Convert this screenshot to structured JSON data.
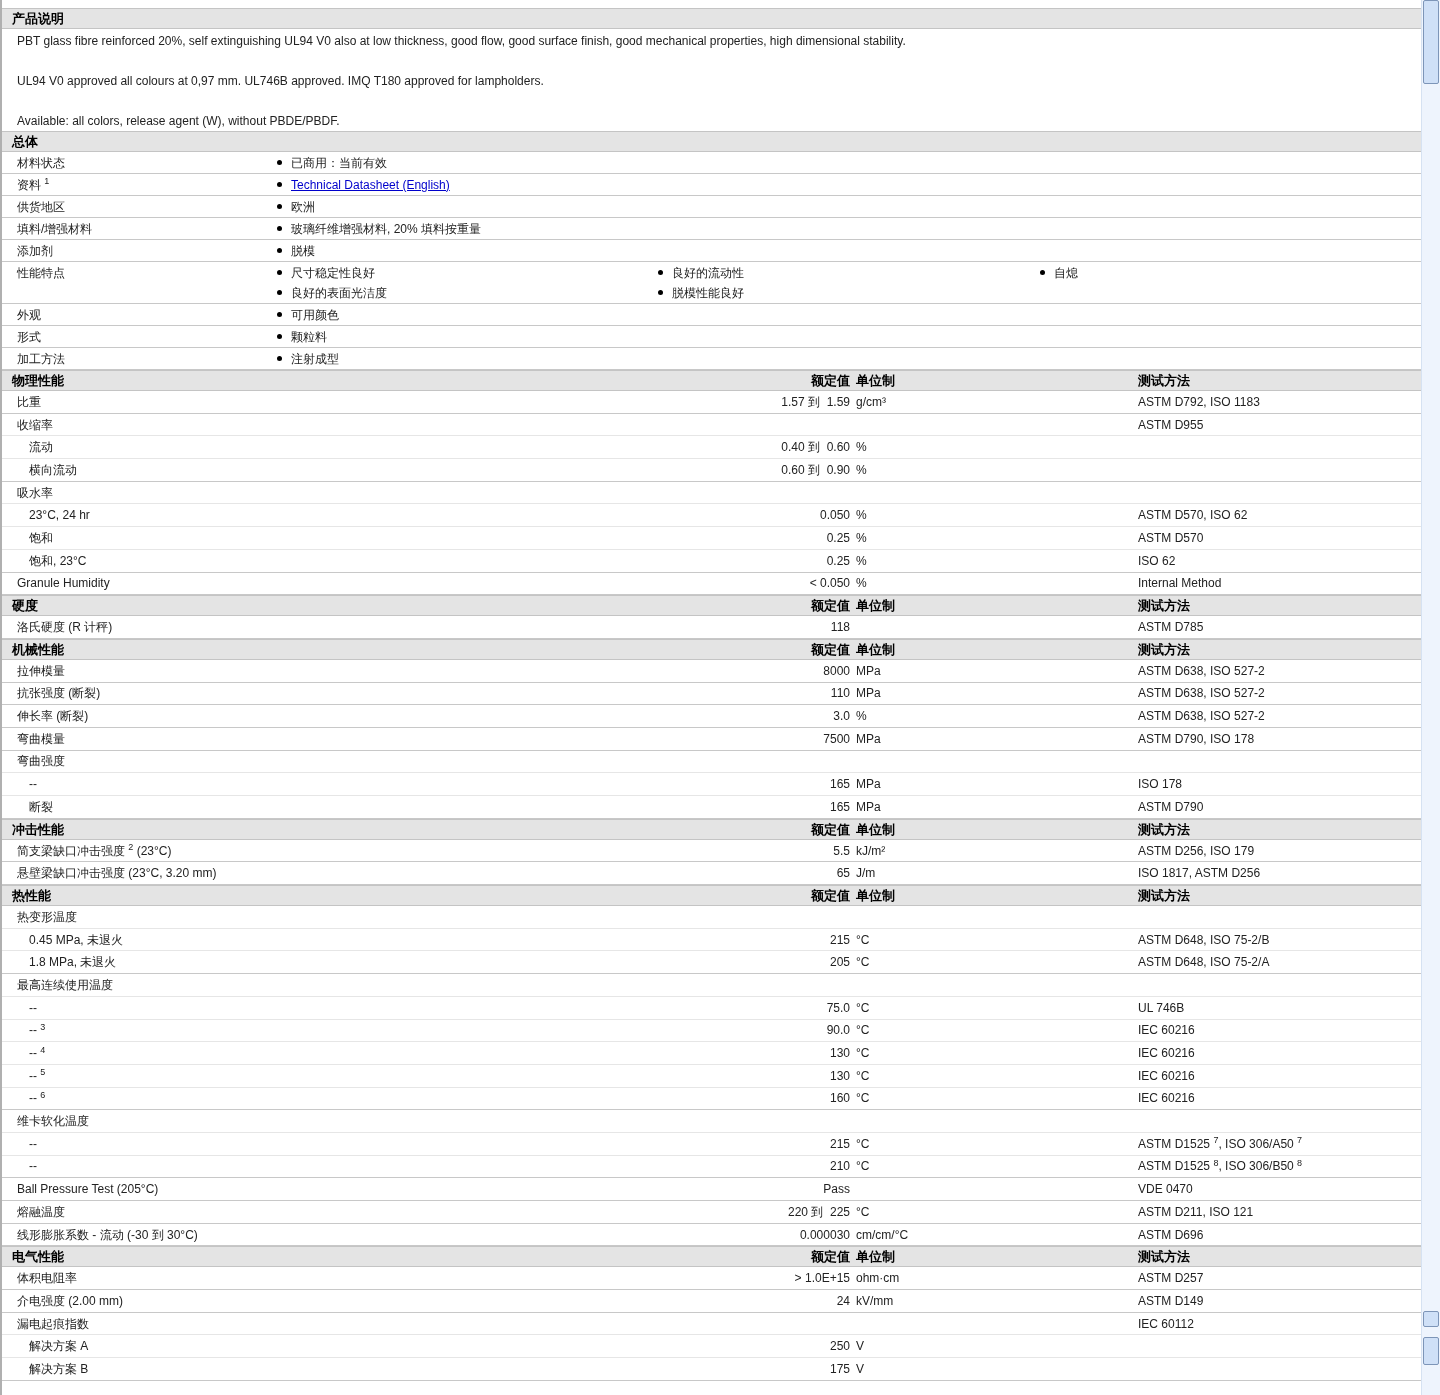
{
  "description": {
    "title": "产品说明",
    "paragraphs": [
      "PBT glass fibre reinforced 20%, self extinguishing UL94 V0 also at low thickness, good flow, good surface finish, good mechanical properties, high dimensional stability.",
      "UL94 V0 approved all colours at 0,97 mm. UL746B approved. IMQ T180 approved for lampholders.",
      "Available: all colors, release agent (W), without PBDE/PBDF."
    ]
  },
  "general": {
    "title": "总体",
    "rows": [
      {
        "label": "材料状态",
        "items": [
          {
            "text": "已商用：当前有效",
            "kind": "text"
          }
        ]
      },
      {
        "label": "资料 $^{1}$",
        "items": [
          {
            "text": "Technical Datasheet (English)",
            "kind": "link"
          }
        ]
      },
      {
        "label": "供货地区",
        "items": [
          {
            "text": "欧洲",
            "kind": "text"
          }
        ]
      },
      {
        "label": "填料/增强材料",
        "items": [
          {
            "text": "玻璃纤维增强材料, 20% 填料按重量",
            "kind": "text"
          }
        ]
      },
      {
        "label": "添加剂",
        "items": [
          {
            "text": "脱模",
            "kind": "text"
          }
        ]
      },
      {
        "label": "性能特点",
        "items": [
          {
            "text": "尺寸稳定性良好",
            "kind": "text"
          },
          {
            "text": "良好的流动性",
            "kind": "text"
          },
          {
            "text": "自熄",
            "kind": "text"
          },
          {
            "text": "良好的表面光洁度",
            "kind": "text"
          },
          {
            "text": "脱模性能良好",
            "kind": "text"
          }
        ]
      },
      {
        "label": "外观",
        "items": [
          {
            "text": "可用颜色",
            "kind": "text"
          }
        ]
      },
      {
        "label": "形式",
        "items": [
          {
            "text": "颗粒料",
            "kind": "text"
          }
        ]
      },
      {
        "label": "加工方法",
        "items": [
          {
            "text": "注射成型",
            "kind": "text"
          }
        ]
      }
    ]
  },
  "sections": [
    {
      "title": "物理性能",
      "value_heading": "额定值",
      "unit_heading": "单位制",
      "method_heading": "测试方法",
      "rows": [
        {
          "label": "比重",
          "value": "1.57 到  1.59",
          "unit": "g/cm³",
          "method": "ASTM D792, ISO 1183"
        },
        {
          "label": "收缩率",
          "method": "ASTM D955",
          "children": [
            {
              "label": "流动",
              "value": "0.40 到  0.60",
              "unit": "%"
            },
            {
              "label": "横向流动",
              "value": "0.60 到  0.90",
              "unit": "%"
            }
          ]
        },
        {
          "label": "吸水率",
          "children": [
            {
              "label": "23°C, 24 hr",
              "value": "0.050",
              "unit": "%",
              "method": "ASTM D570, ISO 62"
            },
            {
              "label": "饱和",
              "value": "0.25",
              "unit": "%",
              "method": "ASTM D570"
            },
            {
              "label": "饱和, 23°C",
              "value": "0.25",
              "unit": "%",
              "method": "ISO 62"
            }
          ]
        },
        {
          "label": "Granule Humidity",
          "value": "< 0.050",
          "unit": "%",
          "method": "Internal Method"
        }
      ]
    },
    {
      "title": "硬度",
      "value_heading": "额定值",
      "unit_heading": "单位制",
      "method_heading": "测试方法",
      "rows": [
        {
          "label": "洛氏硬度 (R 计秤)",
          "value": "118",
          "method": "ASTM D785"
        }
      ]
    },
    {
      "title": "机械性能",
      "value_heading": "额定值",
      "unit_heading": "单位制",
      "method_heading": "测试方法",
      "rows": [
        {
          "label": "拉伸模量",
          "value": "8000",
          "unit": "MPa",
          "method": "ASTM D638, ISO 527-2"
        },
        {
          "label": "抗张强度 (断裂)",
          "value": "110",
          "unit": "MPa",
          "method": "ASTM D638, ISO 527-2"
        },
        {
          "label": "伸长率 (断裂)",
          "value": "3.0",
          "unit": "%",
          "method": "ASTM D638, ISO 527-2"
        },
        {
          "label": "弯曲模量",
          "value": "7500",
          "unit": "MPa",
          "method": "ASTM D790, ISO 178"
        },
        {
          "label": "弯曲强度",
          "children": [
            {
              "label": "--",
              "value": "165",
              "unit": "MPa",
              "method": "ISO 178"
            },
            {
              "label": "断裂",
              "value": "165",
              "unit": "MPa",
              "method": "ASTM D790"
            }
          ]
        }
      ]
    },
    {
      "title": "冲击性能",
      "value_heading": "额定值",
      "unit_heading": "单位制",
      "method_heading": "测试方法",
      "rows": [
        {
          "label": "简支梁缺口冲击强度 $^{2}$ (23°C)",
          "value": "5.5",
          "unit": "kJ/m²",
          "method": "ASTM D256, ISO 179"
        },
        {
          "label": "悬壁梁缺口冲击强度 (23°C, 3.20 mm)",
          "value": "65",
          "unit": "J/m",
          "method": "ISO 1817, ASTM D256"
        }
      ]
    },
    {
      "title": "热性能",
      "value_heading": "额定值",
      "unit_heading": "单位制",
      "method_heading": "测试方法",
      "rows": [
        {
          "label": "热变形温度",
          "children": [
            {
              "label": "0.45 MPa, 未退火",
              "value": "215",
              "unit": "°C",
              "method": "ASTM D648, ISO 75-2/B"
            },
            {
              "label": "1.8 MPa, 未退火",
              "value": "205",
              "unit": "°C",
              "method": "ASTM D648, ISO 75-2/A"
            }
          ]
        },
        {
          "label": "最高连续使用温度",
          "children": [
            {
              "label": "--",
              "value": "75.0",
              "unit": "°C",
              "method": "UL 746B"
            },
            {
              "label": "-- $^{3}$",
              "value": "90.0",
              "unit": "°C",
              "method": "IEC 60216"
            },
            {
              "label": "-- $^{4}$",
              "value": "130",
              "unit": "°C",
              "method": "IEC 60216"
            },
            {
              "label": "-- $^{5}$",
              "value": "130",
              "unit": "°C",
              "method": "IEC 60216"
            },
            {
              "label": "-- $^{6}$",
              "value": "160",
              "unit": "°C",
              "method": "IEC 60216"
            }
          ]
        },
        {
          "label": "维卡软化温度",
          "children": [
            {
              "label": "--",
              "value": "215",
              "unit": "°C",
              "method": "ASTM D1525 $^{7}$, ISO 306/A50 $^{7}$"
            },
            {
              "label": "--",
              "value": "210",
              "unit": "°C",
              "method": "ASTM D1525 $^{8}$, ISO 306/B50 $^{8}$"
            }
          ]
        },
        {
          "label": "Ball Pressure Test (205°C)",
          "value": "Pass",
          "method": "VDE 0470"
        },
        {
          "label": "熔融温度",
          "value": "220 到  225",
          "unit": "°C",
          "method": "ASTM D211, ISO 121"
        },
        {
          "label": "线形膨胀系数 - 流动 (-30 到  30°C)",
          "value": "0.000030",
          "unit": "cm/cm/°C",
          "method": "ASTM D696"
        }
      ]
    },
    {
      "title": "电气性能",
      "value_heading": "额定值",
      "unit_heading": "单位制",
      "method_heading": "测试方法",
      "rows": [
        {
          "label": "体积电阻率",
          "value": "> 1.0E+15",
          "unit": "ohm·cm",
          "method": "ASTM D257"
        },
        {
          "label": "介电强度 (2.00 mm)",
          "value": "24",
          "unit": "kV/mm",
          "method": "ASTM D149"
        },
        {
          "label": "漏电起痕指数",
          "method": "IEC 60112",
          "children": [
            {
              "label": "解决方案 A",
              "value": "250",
              "unit": "V"
            },
            {
              "label": "解决方案 B",
              "value": "175",
              "unit": "V"
            }
          ]
        }
      ]
    }
  ]
}
